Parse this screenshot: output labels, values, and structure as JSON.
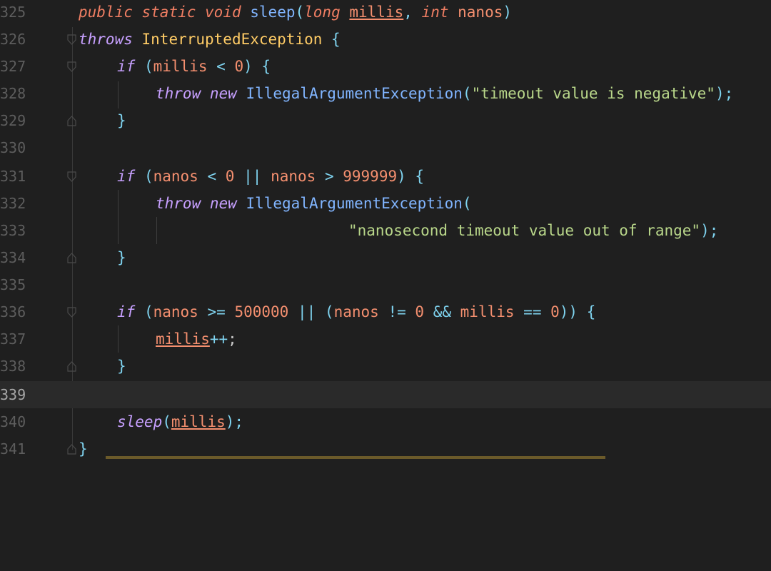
{
  "editor": {
    "line_numbers": [
      "325",
      "326",
      "327",
      "328",
      "329",
      "330",
      "331",
      "332",
      "333",
      "334",
      "335",
      "336",
      "337",
      "338",
      "339",
      "340",
      "341"
    ],
    "current_line": "339",
    "code": {
      "l325": {
        "t1": "public",
        "t2": "static",
        "t3": "void",
        "t4": "sleep",
        "t5": "(",
        "t6": "long",
        "t7": "millis",
        "t8": ",",
        "t9": "int",
        "t10": "nanos",
        "t11": ")"
      },
      "l326": {
        "t1": "throws",
        "t2": "InterruptedException",
        "t3": "{"
      },
      "l327": {
        "t1": "if",
        "t2": "(",
        "t3": "millis",
        "t4": "<",
        "t5": "0",
        "t6": ")",
        "t7": "{"
      },
      "l328": {
        "t1": "throw",
        "t2": "new",
        "t3": "IllegalArgumentException",
        "t4": "(",
        "t5": "\"timeout value is negative\"",
        "t6": ");"
      },
      "l329": {
        "t1": "}"
      },
      "l331": {
        "t1": "if",
        "t2": "(",
        "t3": "nanos",
        "t4": "<",
        "t5": "0",
        "t6": "||",
        "t7": "nanos",
        "t8": ">",
        "t9": "999999",
        "t10": ")",
        "t11": "{"
      },
      "l332": {
        "t1": "throw",
        "t2": "new",
        "t3": "IllegalArgumentException",
        "t4": "("
      },
      "l333": {
        "t1": "\"nanosecond timeout value out of range\"",
        "t2": ");"
      },
      "l334": {
        "t1": "}"
      },
      "l336": {
        "t1": "if",
        "t2": "(",
        "t3": "nanos",
        "t4": ">=",
        "t5": "500000",
        "t6": "||",
        "t7": "(",
        "t8": "nanos",
        "t9": "!=",
        "t10": "0",
        "t11": "&&",
        "t12": "millis",
        "t13": "==",
        "t14": "0",
        "t15": "))",
        "t16": "{"
      },
      "l337": {
        "t1": "millis",
        "t2": "++",
        "t3": ";"
      },
      "l338": {
        "t1": "}"
      },
      "l340": {
        "t1": "sleep",
        "t2": "(",
        "t3": "millis",
        "t4": ");"
      },
      "l341": {
        "t1": "}"
      }
    },
    "colors": {
      "background": "#1f1f1f",
      "current_line": "#2a2a2a",
      "keyword": "#f07e63",
      "type": "#ffcc66",
      "function": "#81b5ff",
      "string": "#b9d78a",
      "operator": "#7fd3ef"
    },
    "icons": [
      "fold-open-icon",
      "fold-close-icon"
    ]
  }
}
